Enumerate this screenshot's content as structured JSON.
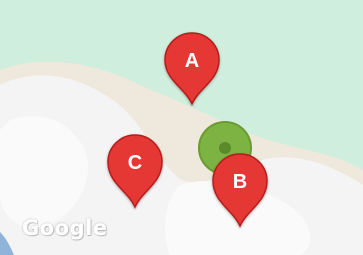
{
  "map": {
    "land_color": "#cfeedd",
    "cloud_color": "#f4f4f4",
    "pin_color": "#e53935",
    "pin_label_color": "#ffffff",
    "user_location_color": "#7cb342"
  },
  "markers": [
    {
      "label": "A"
    },
    {
      "label": "B"
    },
    {
      "label": "C"
    }
  ],
  "branding": {
    "logo_text": "Google"
  }
}
